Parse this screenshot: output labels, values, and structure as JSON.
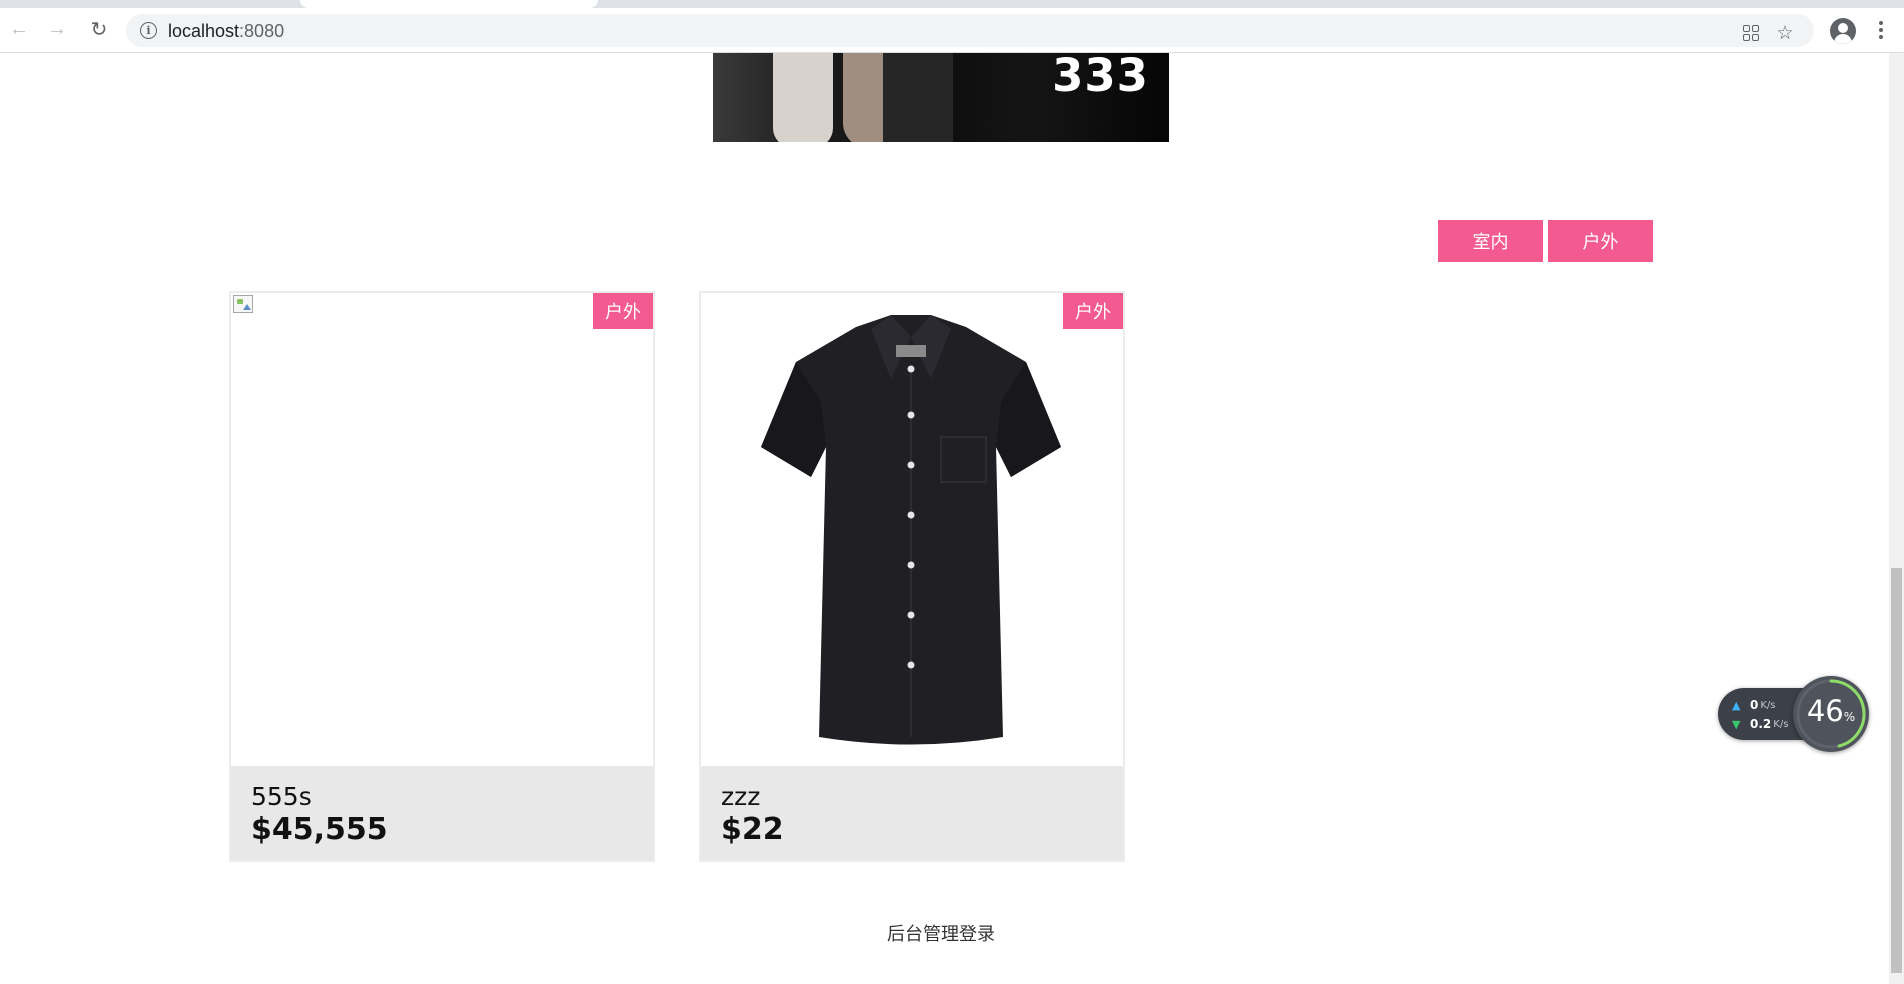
{
  "browser": {
    "url_host": "localhost",
    "url_port": ":8080",
    "icons": {
      "back": "arrow-left-icon",
      "forward": "arrow-right-icon",
      "reload": "reload-icon",
      "site_info": "info-icon",
      "apps": "grid-icon",
      "bookmark": "star-icon",
      "profile": "profile-icon",
      "menu": "more-vert-icon"
    }
  },
  "banner": {
    "text": "333"
  },
  "filters": [
    {
      "label": "室内"
    },
    {
      "label": "户外"
    }
  ],
  "products": [
    {
      "name": "555s",
      "price": "$45,555",
      "tag": "户外",
      "image": "broken-image"
    },
    {
      "name": "zzz",
      "price": "$22",
      "tag": "户外",
      "image": "black-shirt"
    }
  ],
  "footer": {
    "admin_login": "后台管理登录"
  },
  "net_monitor": {
    "upload_value": "0",
    "upload_unit": "K/s",
    "download_value": "0.2",
    "download_unit": "K/s",
    "cpu_percent": "46",
    "cpu_symbol": "%"
  },
  "colors": {
    "accent": "#f35a90",
    "card_info_bg": "#e8e8e8"
  }
}
